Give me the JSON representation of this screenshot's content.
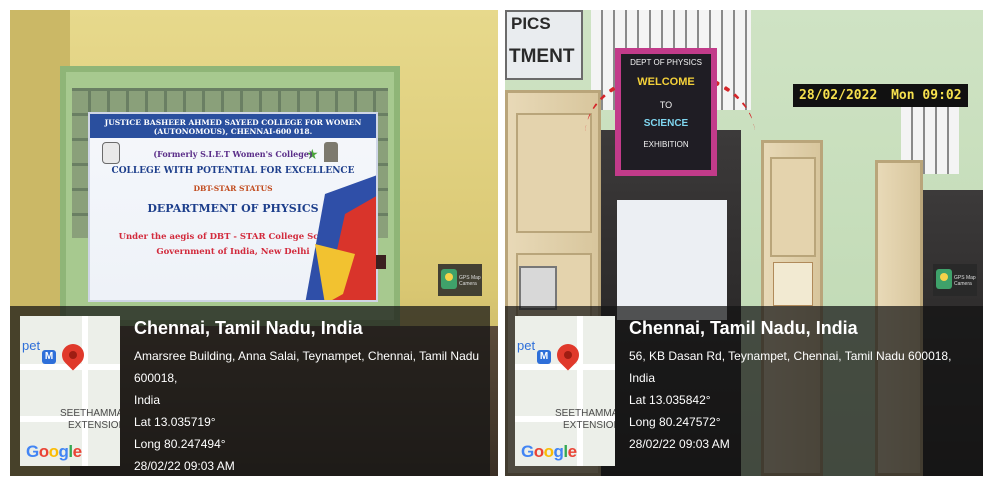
{
  "photos": [
    {
      "banner": {
        "line1": "JUSTICE BASHEER AHMED SAYEED COLLEGE FOR WOMEN",
        "line2": "(AUTONOMOUS), CHENNAI-600 018.",
        "line3": "(Formerly S.I.E.T Women's College)",
        "line4": "COLLEGE WITH POTENTIAL FOR EXCELLENCE",
        "line5": "DBT-STAR STATUS",
        "line6": "DEPARTMENT OF PHYSICS",
        "line7": "Under the aegis of DBT - STAR College Scheme,",
        "line8": "Government of India, New Delhi"
      },
      "map": {
        "pet": "pet",
        "area1": "SEETHAMMAL",
        "area2": "EXTENSION",
        "logo": [
          "G",
          "o",
          "o",
          "g",
          "l",
          "e"
        ]
      },
      "badge": "GPS Map Camera",
      "gps": {
        "city": "Chennai, Tamil Nadu, India",
        "address1": "Amarsree Building, Anna Salai, Teynampet, Chennai, Tamil Nadu 600018,",
        "address2": "India",
        "lat": "Lat 13.035719°",
        "long": "Long 80.247494°",
        "datetime": "28/02/22 09:03 AM"
      }
    },
    {
      "sign": {
        "top1": "PICS",
        "top2": "TMENT"
      },
      "welcome": {
        "l1": "DEPT OF PHYSICS",
        "l2": "WELCOME",
        "l3": "TO",
        "l4": "SCIENCE",
        "l5": "EXHIBITION"
      },
      "clock": {
        "date": "28/02/2022",
        "time": "Mon 09:02"
      },
      "map": {
        "pet": "pet",
        "area1": "SEETHAMMAL",
        "area2": "EXTENSION",
        "logo": [
          "G",
          "o",
          "o",
          "g",
          "l",
          "e"
        ]
      },
      "badge": "GPS Map Camera",
      "gps": {
        "city": "Chennai, Tamil Nadu, India",
        "address1": "56, KB Dasan Rd, Teynampet, Chennai, Tamil Nadu 600018, India",
        "lat": "Lat 13.035842°",
        "long": "Long 80.247572°",
        "datetime": "28/02/22 09:03 AM"
      }
    }
  ]
}
